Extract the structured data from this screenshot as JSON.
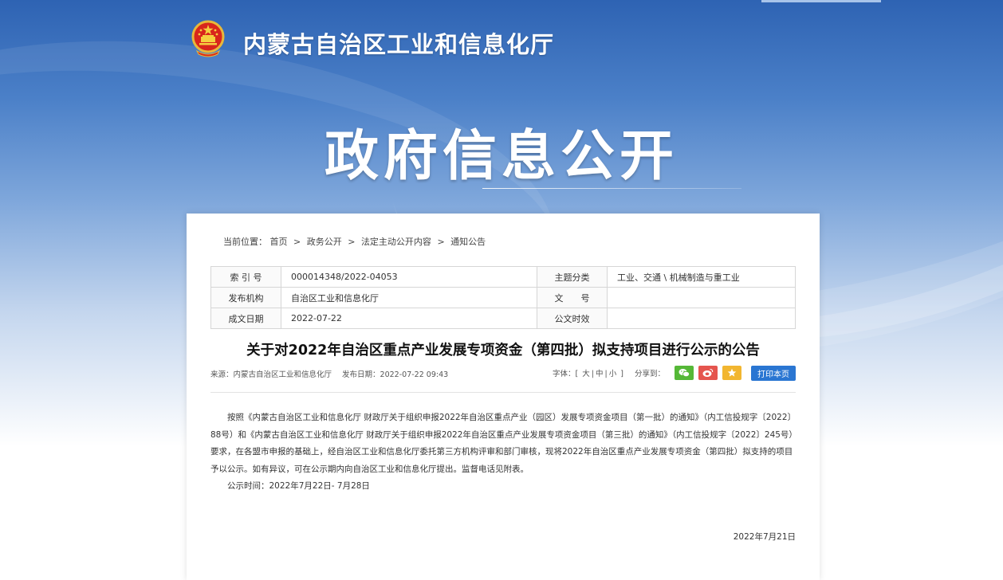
{
  "site": {
    "name": "内蒙古自治区工业和信息化厅",
    "section_title": "政府信息公开"
  },
  "breadcrumb": {
    "prefix": "当前位置：",
    "items": [
      "首页",
      "政务公开",
      "法定主动公开内容",
      "通知公告"
    ],
    "separator": ">"
  },
  "meta": {
    "index_label": "索 引 号",
    "index_value": "000014348/2022-04053",
    "topic_label": "主题分类",
    "topic_value": "工业、交通 \\ 机械制造与重工业",
    "publisher_label": "发布机构",
    "publisher_value": "自治区工业和信息化厅",
    "docno_label": "文　　号",
    "docno_value": "",
    "date_label": "成文日期",
    "date_value": "2022-07-22",
    "validity_label": "公文时效",
    "validity_value": ""
  },
  "article": {
    "title": "关于对2022年自治区重点产业发展专项资金（第四批）拟支持项目进行公示的公告",
    "source": "来源：内蒙古自治区工业和信息化厅",
    "publish_time": "发布日期：2022-07-22 09:43",
    "paragraph1": "按照《内蒙古自治区工业和信息化厅 财政厅关于组织申报2022年自治区重点产业（园区）发展专项资金项目（第一批）的通知》（内工信投规字〔2022〕88号）和《内蒙古自治区工业和信息化厅 财政厅关于组织申报2022年自治区重点产业发展专项资金项目（第三批）的通知》（内工信投规字〔2022〕245号）要求，在各盟市申报的基础上，经自治区工业和信息化厅委托第三方机构评审和部门审核，现将2022年自治区重点产业发展专项资金（第四批）拟支持的项目予以公示。如有异议，可在公示期内向自治区工业和信息化厅提出。监督电话见附表。",
    "paragraph2": "公示时间：2022年7月22日- 7月28日",
    "sign_date": "2022年7月21日"
  },
  "tools": {
    "font_label": "字体：",
    "font_open": "[",
    "font_large": "大",
    "font_mid": "中",
    "font_small": "小",
    "font_close": "]",
    "font_sep": "|",
    "share_label": "分享到：",
    "print_label": "打印本页"
  },
  "icons": {
    "emblem": "national-emblem",
    "wechat": "wechat-icon",
    "weibo": "weibo-icon",
    "favorite": "star-icon"
  },
  "colors": {
    "banner_blue": "#2e63b3",
    "print_button": "#2a76d2",
    "wechat_green": "#55b837",
    "weibo_red": "#e5554e",
    "favorite_yellow": "#f2b630"
  }
}
